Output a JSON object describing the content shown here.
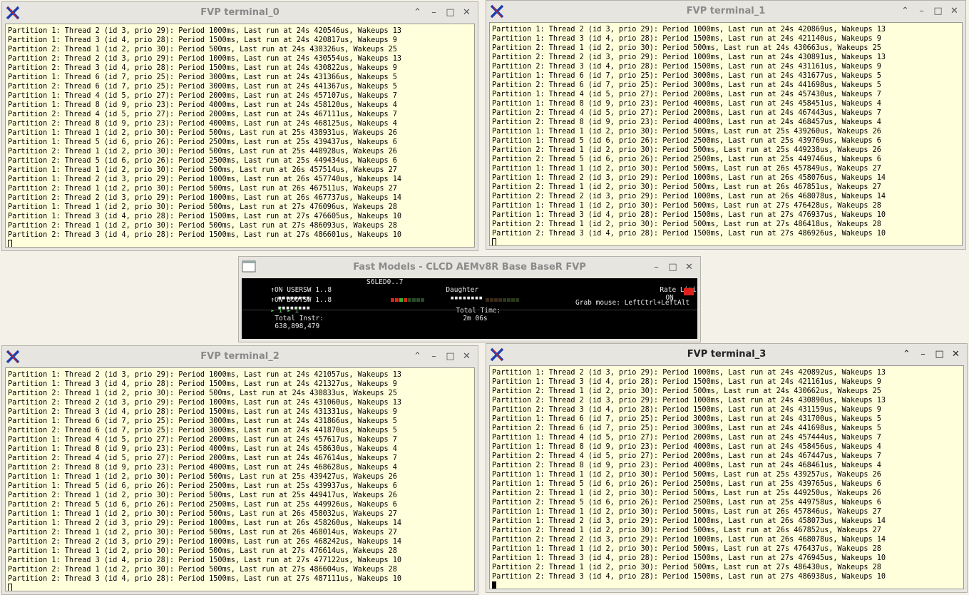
{
  "windows": {
    "term0": {
      "title": "FVP terminal_0",
      "lines": [
        "Partition 1: Thread 2 (id 3, prio 29): Period 1000ms, Last run at 24s 420546us, Wakeups 13",
        "Partition 1: Thread 3 (id 4, prio 28): Period 1500ms, Last run at 24s 420817us, Wakeups 9",
        "Partition 2: Thread 1 (id 2, prio 30): Period 500ms, Last run at 24s 430326us, Wakeups 25",
        "Partition 2: Thread 2 (id 3, prio 29): Period 1000ms, Last run at 24s 430554us, Wakeups 13",
        "Partition 2: Thread 3 (id 4, prio 28): Period 1500ms, Last run at 24s 430822us, Wakeups 9",
        "Partition 1: Thread 6 (id 7, prio 25): Period 3000ms, Last run at 24s 431366us, Wakeups 5",
        "Partition 2: Thread 6 (id 7, prio 25): Period 3000ms, Last run at 24s 441367us, Wakeups 5",
        "Partition 1: Thread 4 (id 5, prio 27): Period 2000ms, Last run at 24s 457107us, Wakeups 7",
        "Partition 1: Thread 8 (id 9, prio 23): Period 4000ms, Last run at 24s 458120us, Wakeups 4",
        "Partition 2: Thread 4 (id 5, prio 27): Period 2000ms, Last run at 24s 467111us, Wakeups 7",
        "Partition 2: Thread 8 (id 9, prio 23): Period 4000ms, Last run at 24s 468125us, Wakeups 4",
        "Partition 1: Thread 1 (id 2, prio 30): Period 500ms, Last run at 25s 438931us, Wakeups 26",
        "Partition 1: Thread 5 (id 6, prio 26): Period 2500ms, Last run at 25s 439437us, Wakeups 6",
        "Partition 2: Thread 1 (id 2, prio 30): Period 500ms, Last run at 25s 448928us, Wakeups 26",
        "Partition 2: Thread 5 (id 6, prio 26): Period 2500ms, Last run at 25s 449434us, Wakeups 6",
        "Partition 1: Thread 1 (id 2, prio 30): Period 500ms, Last run at 26s 457514us, Wakeups 27",
        "Partition 1: Thread 2 (id 3, prio 29): Period 1000ms, Last run at 26s 457740us, Wakeups 14",
        "Partition 2: Thread 1 (id 2, prio 30): Period 500ms, Last run at 26s 467511us, Wakeups 27",
        "Partition 2: Thread 2 (id 3, prio 29): Period 1000ms, Last run at 26s 467737us, Wakeups 14",
        "Partition 1: Thread 1 (id 2, prio 30): Period 500ms, Last run at 27s 476096us, Wakeups 28",
        "Partition 1: Thread 3 (id 4, prio 28): Period 1500ms, Last run at 27s 476605us, Wakeups 10",
        "Partition 2: Thread 1 (id 2, prio 30): Period 500ms, Last run at 27s 486093us, Wakeups 28",
        "Partition 2: Thread 3 (id 4, prio 28): Period 1500ms, Last run at 27s 486601us, Wakeups 10"
      ]
    },
    "term1": {
      "title": "FVP terminal_1",
      "lines": [
        "Partition 1: Thread 2 (id 3, prio 29): Period 1000ms, Last run at 24s 420869us, Wakeups 13",
        "Partition 1: Thread 3 (id 4, prio 28): Period 1500ms, Last run at 24s 421140us, Wakeups 9",
        "Partition 2: Thread 1 (id 2, prio 30): Period 500ms, Last run at 24s 430663us, Wakeups 25",
        "Partition 2: Thread 2 (id 3, prio 29): Period 1000ms, Last run at 24s 430891us, Wakeups 13",
        "Partition 2: Thread 3 (id 4, prio 28): Period 1500ms, Last run at 24s 431161us, Wakeups 9",
        "Partition 1: Thread 6 (id 7, prio 25): Period 3000ms, Last run at 24s 431677us, Wakeups 5",
        "Partition 2: Thread 6 (id 7, prio 25): Period 3000ms, Last run at 24s 441698us, Wakeups 5",
        "Partition 1: Thread 4 (id 5, prio 27): Period 2000ms, Last run at 24s 457430us, Wakeups 7",
        "Partition 1: Thread 8 (id 9, prio 23): Period 4000ms, Last run at 24s 458451us, Wakeups 4",
        "Partition 2: Thread 4 (id 5, prio 27): Period 2000ms, Last run at 24s 467443us, Wakeups 7",
        "Partition 2: Thread 8 (id 9, prio 23): Period 4000ms, Last run at 24s 468457us, Wakeups 4",
        "Partition 1: Thread 1 (id 2, prio 30): Period 500ms, Last run at 25s 439260us, Wakeups 26",
        "Partition 1: Thread 5 (id 6, prio 26): Period 2500ms, Last run at 25s 439769us, Wakeups 6",
        "Partition 2: Thread 1 (id 2, prio 30): Period 500ms, Last run at 25s 449238us, Wakeups 26",
        "Partition 2: Thread 5 (id 6, prio 26): Period 2500ms, Last run at 25s 449746us, Wakeups 6",
        "Partition 1: Thread 1 (id 2, prio 30): Period 500ms, Last run at 26s 457849us, Wakeups 27",
        "Partition 1: Thread 2 (id 3, prio 29): Period 1000ms, Last run at 26s 458076us, Wakeups 14",
        "Partition 2: Thread 1 (id 2, prio 30): Period 500ms, Last run at 26s 467851us, Wakeups 27",
        "Partition 2: Thread 2 (id 3, prio 29): Period 1000ms, Last run at 26s 468078us, Wakeups 14",
        "Partition 1: Thread 1 (id 2, prio 30): Period 500ms, Last run at 27s 476428us, Wakeups 28",
        "Partition 1: Thread 3 (id 4, prio 28): Period 1500ms, Last run at 27s 476937us, Wakeups 10",
        "Partition 2: Thread 1 (id 2, prio 30): Period 500ms, Last run at 27s 486418us, Wakeups 28",
        "Partition 2: Thread 3 (id 4, prio 28): Period 1500ms, Last run at 27s 486926us, Wakeups 10"
      ]
    },
    "term2": {
      "title": "FVP terminal_2",
      "lines": [
        "Partition 1: Thread 2 (id 3, prio 29): Period 1000ms, Last run at 24s 421057us, Wakeups 13",
        "Partition 1: Thread 3 (id 4, prio 28): Period 1500ms, Last run at 24s 421327us, Wakeups 9",
        "Partition 2: Thread 1 (id 2, prio 30): Period 500ms, Last run at 24s 430833us, Wakeups 25",
        "Partition 2: Thread 2 (id 3, prio 29): Period 1000ms, Last run at 24s 431060us, Wakeups 13",
        "Partition 2: Thread 3 (id 4, prio 28): Period 1500ms, Last run at 24s 431331us, Wakeups 9",
        "Partition 1: Thread 6 (id 7, prio 25): Period 3000ms, Last run at 24s 431866us, Wakeups 5",
        "Partition 2: Thread 6 (id 7, prio 25): Period 3000ms, Last run at 24s 441870us, Wakeups 5",
        "Partition 1: Thread 4 (id 5, prio 27): Period 2000ms, Last run at 24s 457617us, Wakeups 7",
        "Partition 1: Thread 8 (id 9, prio 23): Period 4000ms, Last run at 24s 458630us, Wakeups 4",
        "Partition 2: Thread 4 (id 5, prio 27): Period 2000ms, Last run at 24s 467614us, Wakeups 7",
        "Partition 2: Thread 8 (id 9, prio 23): Period 4000ms, Last run at 24s 468628us, Wakeups 4",
        "Partition 1: Thread 1 (id 2, prio 30): Period 500ms, Last run at 25s 439427us, Wakeups 26",
        "Partition 1: Thread 5 (id 6, prio 26): Period 2500ms, Last run at 25s 439937us, Wakeups 6",
        "Partition 2: Thread 1 (id 2, prio 30): Period 500ms, Last run at 25s 449417us, Wakeups 26",
        "Partition 2: Thread 5 (id 6, prio 26): Period 2500ms, Last run at 25s 449926us, Wakeups 6",
        "Partition 1: Thread 1 (id 2, prio 30): Period 500ms, Last run at 26s 458032us, Wakeups 27",
        "Partition 1: Thread 2 (id 3, prio 29): Period 1000ms, Last run at 26s 458260us, Wakeups 14",
        "Partition 2: Thread 1 (id 2, prio 30): Period 500ms, Last run at 26s 468014us, Wakeups 27",
        "Partition 2: Thread 2 (id 3, prio 29): Period 1000ms, Last run at 26s 468242us, Wakeups 14",
        "Partition 1: Thread 1 (id 2, prio 30): Period 500ms, Last run at 27s 476614us, Wakeups 28",
        "Partition 1: Thread 3 (id 4, prio 28): Period 1500ms, Last run at 27s 477122us, Wakeups 10",
        "Partition 2: Thread 1 (id 2, prio 30): Period 500ms, Last run at 27s 486604us, Wakeups 28",
        "Partition 2: Thread 3 (id 4, prio 28): Period 1500ms, Last run at 27s 487111us, Wakeups 10"
      ]
    },
    "term3": {
      "title": "FVP terminal_3",
      "lines": [
        "Partition 1: Thread 2 (id 3, prio 29): Period 1000ms, Last run at 24s 420892us, Wakeups 13",
        "Partition 1: Thread 3 (id 4, prio 28): Period 1500ms, Last run at 24s 421161us, Wakeups 9",
        "Partition 2: Thread 1 (id 2, prio 30): Period 500ms, Last run at 24s 430662us, Wakeups 25",
        "Partition 2: Thread 2 (id 3, prio 29): Period 1000ms, Last run at 24s 430890us, Wakeups 13",
        "Partition 2: Thread 3 (id 4, prio 28): Period 1500ms, Last run at 24s 431159us, Wakeups 9",
        "Partition 1: Thread 6 (id 7, prio 25): Period 3000ms, Last run at 24s 431700us, Wakeups 5",
        "Partition 2: Thread 6 (id 7, prio 25): Period 3000ms, Last run at 24s 441698us, Wakeups 5",
        "Partition 1: Thread 4 (id 5, prio 27): Period 2000ms, Last run at 24s 457444us, Wakeups 7",
        "Partition 1: Thread 8 (id 9, prio 23): Period 4000ms, Last run at 24s 458456us, Wakeups 4",
        "Partition 2: Thread 4 (id 5, prio 27): Period 2000ms, Last run at 24s 467447us, Wakeups 7",
        "Partition 2: Thread 8 (id 9, prio 23): Period 4000ms, Last run at 24s 468461us, Wakeups 4",
        "Partition 1: Thread 1 (id 2, prio 30): Period 500ms, Last run at 25s 439257us, Wakeups 26",
        "Partition 1: Thread 5 (id 6, prio 26): Period 2500ms, Last run at 25s 439765us, Wakeups 6",
        "Partition 2: Thread 1 (id 2, prio 30): Period 500ms, Last run at 25s 449250us, Wakeups 26",
        "Partition 2: Thread 5 (id 6, prio 26): Period 2500ms, Last run at 25s 449758us, Wakeups 6",
        "Partition 1: Thread 1 (id 2, prio 30): Period 500ms, Last run at 26s 457846us, Wakeups 27",
        "Partition 1: Thread 2 (id 3, prio 29): Period 1000ms, Last run at 26s 458073us, Wakeups 14",
        "Partition 2: Thread 1 (id 2, prio 30): Period 500ms, Last run at 26s 467852us, Wakeups 27",
        "Partition 2: Thread 2 (id 3, prio 29): Period 1000ms, Last run at 26s 468078us, Wakeups 14",
        "Partition 1: Thread 1 (id 2, prio 30): Period 500ms, Last run at 27s 476437us, Wakeups 28",
        "Partition 1: Thread 3 (id 4, prio 28): Period 1500ms, Last run at 27s 476945us, Wakeups 10",
        "Partition 2: Thread 1 (id 2, prio 30): Period 500ms, Last run at 27s 486430us, Wakeups 28",
        "Partition 2: Thread 3 (id 4, prio 28): Period 1500ms, Last run at 27s 486938us, Wakeups 10"
      ]
    },
    "fastmodels": {
      "title": "Fast Models - CLCD AEMv8R Base BaseR FVP",
      "usersw_label": "↑ON USERSW 1..8",
      "bootsw_label": "↑ON BOOTSW 1..8",
      "s6led_label": "S6LED0..7",
      "daughter_label": "Daughter",
      "rate_limit_label": "Rate Limit",
      "rate_limit_value": "ON",
      "total_instr_label": "Total Instr:",
      "total_instr_value": "638,898,479",
      "total_time_label": "Total Time:",
      "total_time_value": "2m 06s",
      "grab_mouse_label": "Grab mouse: LeftCtrl+LeftAlt",
      "play_controls": "▸ I ▸ I"
    }
  },
  "icons": {
    "app": "x-window-icon",
    "minimize_glyph": "⏤",
    "maximize_glyph": "□",
    "close_glyph": "✕",
    "shade_glyph": "^"
  },
  "colors": {
    "terminal_bg": "#ffffdc",
    "led_red": "#e0201a",
    "led_green": "#38b030"
  }
}
